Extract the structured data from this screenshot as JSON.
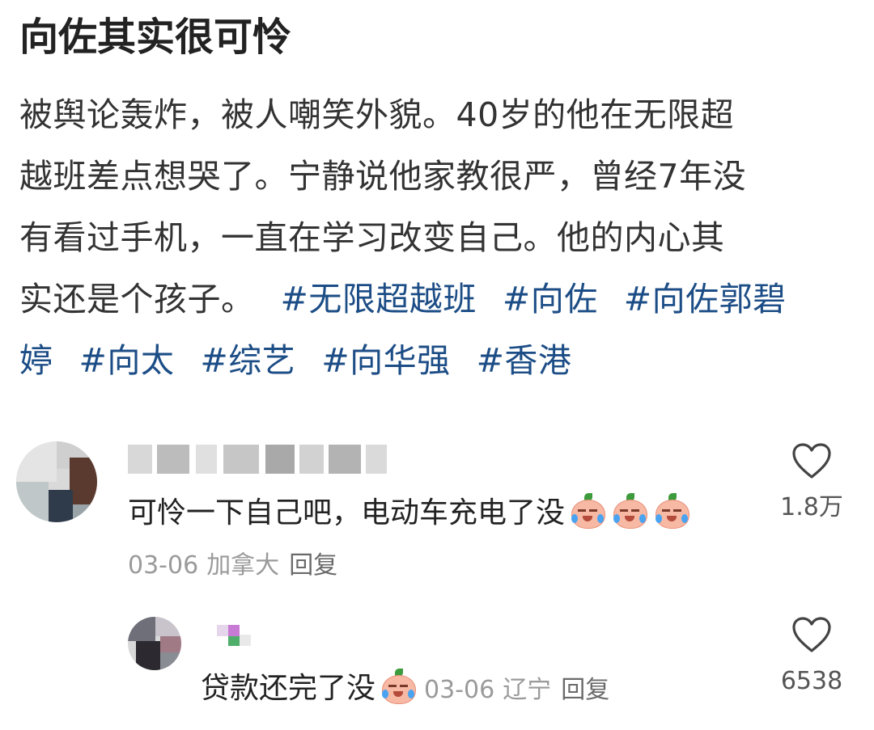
{
  "post": {
    "title": "向佐其实很可怜",
    "body_lines": [
      "被舆论轰炸，被人嘲笑外貌。40岁的他在无限超",
      "越班差点想哭了。宁静说他家教很严，曾经7年没",
      "有看过手机，一直在学习改变自己。他的内心其",
      "实还是个孩子。"
    ],
    "tags": [
      "#无限超越班",
      "#向佐",
      "#向佐郭碧",
      "婷",
      "#向太",
      "#综艺",
      "#向华强",
      "#香港"
    ]
  },
  "comments": [
    {
      "text": "可怜一下自己吧，电动车充电了没",
      "emoji": "crying-peach-emoji",
      "emoji_count": 3,
      "date": "03-06",
      "location": "加拿大",
      "reply_label": "回复",
      "like_count": "1.8万"
    },
    {
      "text": "贷款还完了没",
      "emoji": "crying-peach-emoji",
      "emoji_count": 1,
      "date": "03-06",
      "location": "辽宁",
      "reply_label": "回复",
      "like_count": "6538"
    }
  ],
  "icons": {
    "like": "heart-outline-icon"
  },
  "colors": {
    "tag": "#1c4d86",
    "text": "#333333",
    "meta": "#9a9a9a",
    "background": "#ffffff"
  }
}
